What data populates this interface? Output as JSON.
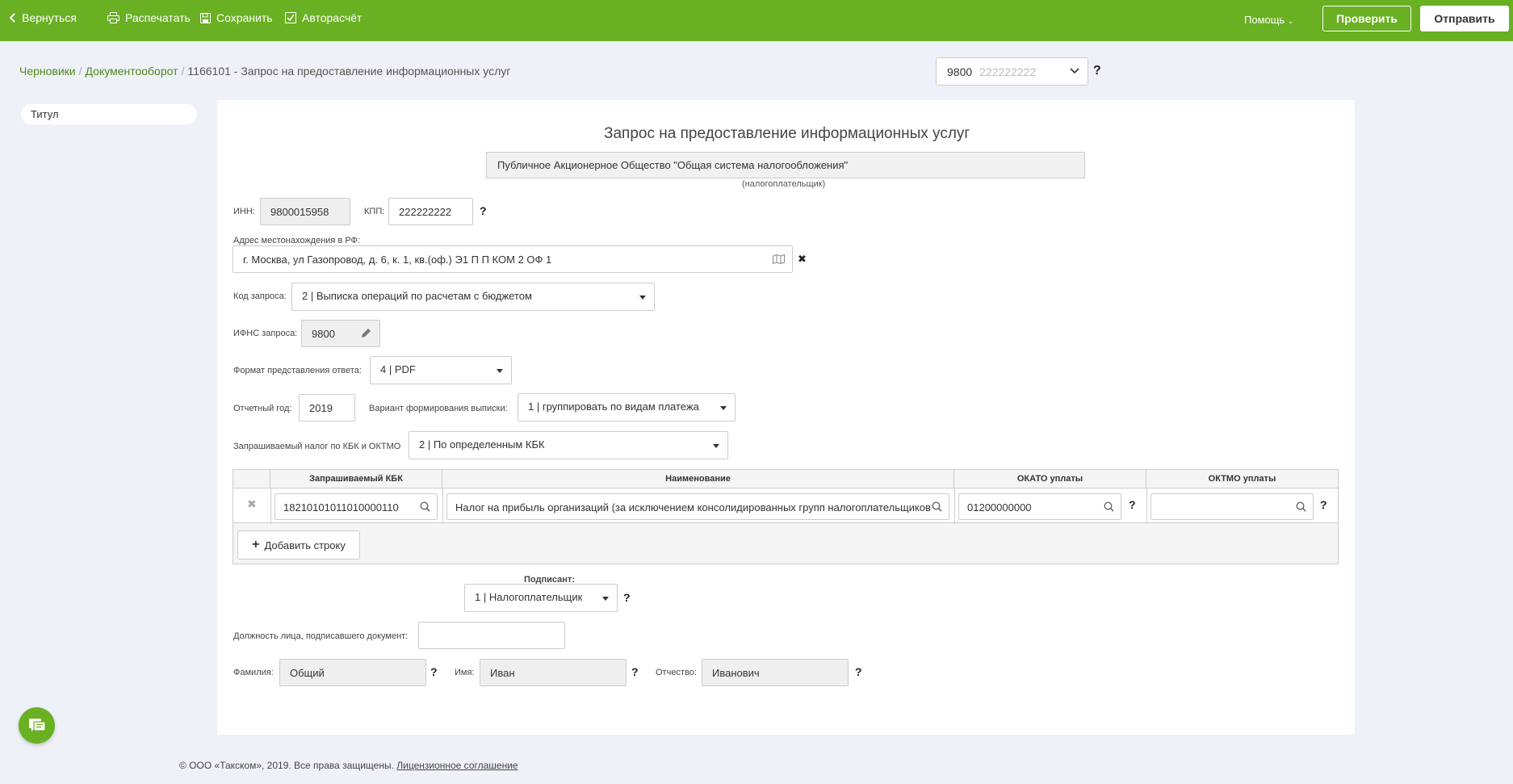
{
  "toolbar": {
    "back_label": "Вернуться",
    "print_label": "Распечатать",
    "save_label": "Сохранить",
    "autocalc_label": "Авторасчёт",
    "help_label": "Помощь",
    "check_label": "Проверить",
    "send_label": "Отправить"
  },
  "breadcrumb": {
    "items": [
      "Черновики",
      "Документооборот"
    ],
    "current": "1166101 - Запрос на предоставление информационных услуг"
  },
  "org_selector": {
    "inn_prefix": "9800",
    "kpp": "222222222"
  },
  "sidebar": {
    "items": [
      {
        "label": "Титул"
      }
    ]
  },
  "form": {
    "title": "Запрос на предоставление информационных услуг",
    "taxpayer_name": "Публичное Акционерное Общество \"Общая система налогообложения\"",
    "taxpayer_caption": "(налогоплательщик)",
    "inn_label": "ИНН:",
    "inn_value": "9800015958",
    "kpp_label": "КПП:",
    "kpp_value": "222222222",
    "address_label": "Адрес местонахождения в РФ:",
    "address_value": "г. Москва, ул Газопровод, д. 6, к. 1, кв.(оф.) Э1 П П КОМ 2 ОФ 1",
    "request_code_label": "Код запроса:",
    "request_code_value": "2 | Выписка операций по расчетам с бюджетом",
    "ifns_label": "ИФНС запроса:",
    "ifns_value": "9800",
    "format_label": "Формат представления ответа:",
    "format_value": "4 | PDF",
    "year_label": "Отчетный год:",
    "year_value": "2019",
    "variant_label": "Вариант формирования выписки:",
    "variant_value": "1 | группировать по видам платежа",
    "tax_label": "Запрашиваемый налог по КБК и ОКТМО",
    "tax_value": "2 | По определенным КБК",
    "table": {
      "headers": [
        "Запрашиваемый КБК",
        "Наименование",
        "ОКАТО уплаты",
        "ОКТМО уплаты"
      ],
      "rows": [
        {
          "kbk": "18210101011010000110",
          "name": "Налог на прибыль организаций (за исключением консолидированных групп налогоплательщиков",
          "okato": "01200000000",
          "oktmo": ""
        }
      ],
      "add_row_label": "Добавить строку"
    },
    "signer_label": "Подписант:",
    "signer_value": "1 | Налогоплательщик",
    "position_label": "Должность лица, подписавшего документ:",
    "position_value": "",
    "surname_label": "Фамилия:",
    "surname_value": "Общий",
    "name_label": "Имя:",
    "name_value": "Иван",
    "patronymic_label": "Отчество:",
    "patronymic_value": "Иванович",
    "help_mark": "?"
  },
  "footer": {
    "copyright": "© ООО «Такском», 2019. Все права защищены.",
    "license_link": "Лицензионное соглашение"
  },
  "colors": {
    "brand_green": "#6ab023",
    "link_green": "#4e8a1c"
  }
}
